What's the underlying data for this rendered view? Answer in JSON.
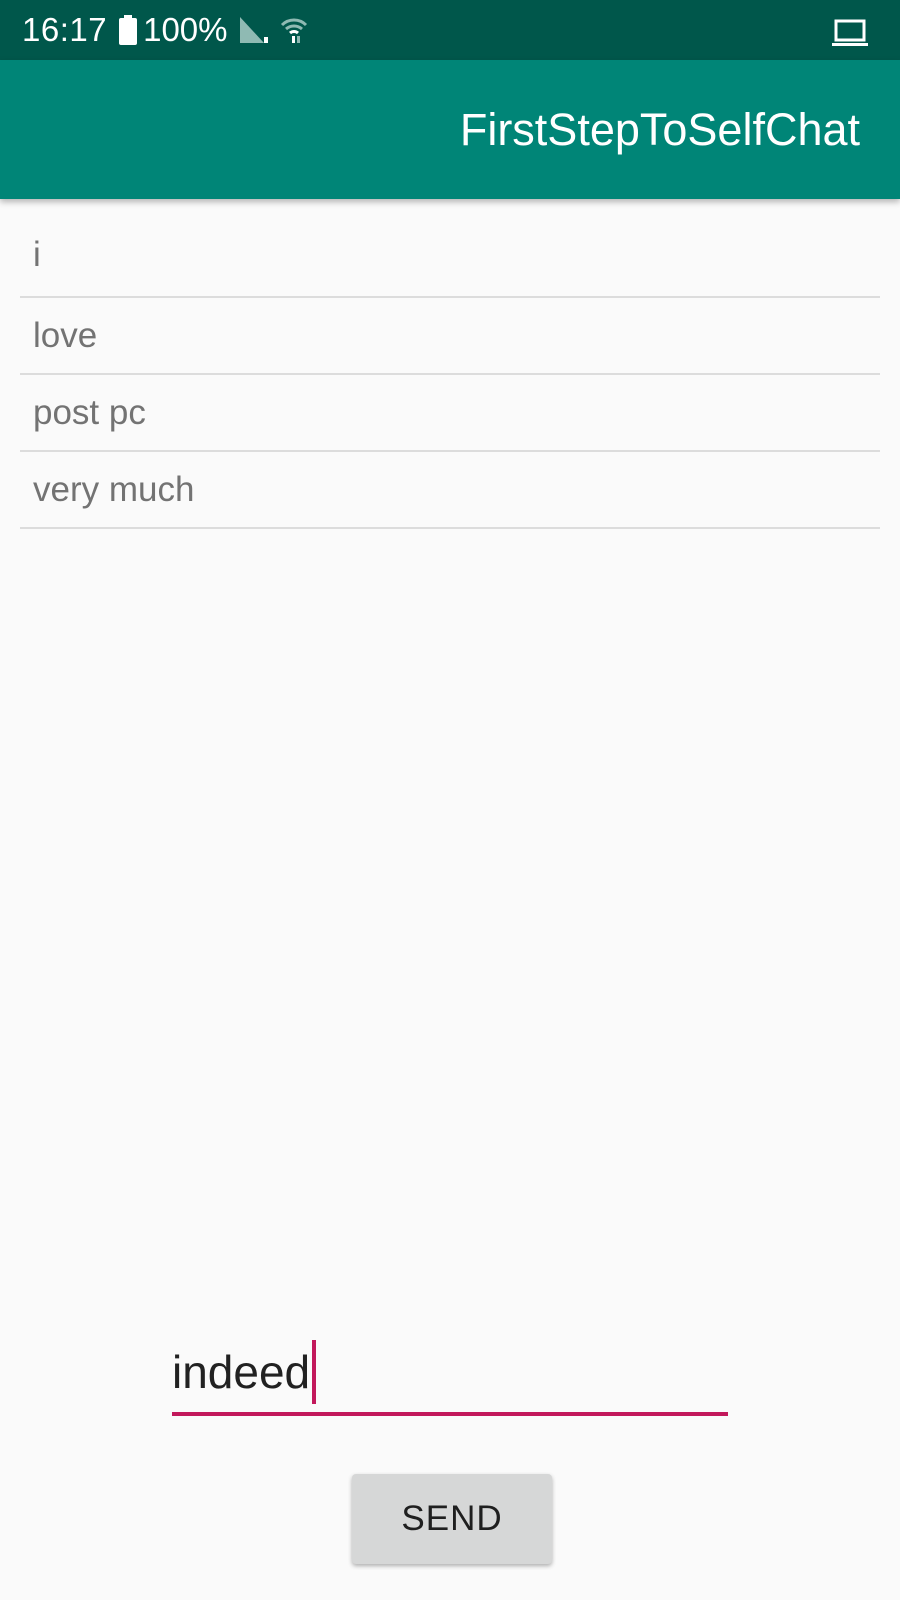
{
  "status_bar": {
    "time": "16:17",
    "battery_percent": "100%",
    "icons": [
      "battery-icon",
      "signal-icon",
      "wifi-icon",
      "laptop-icon"
    ]
  },
  "app_bar": {
    "title": "FirstStepToSelfChat",
    "color": "#008577"
  },
  "messages": [
    "i",
    "love",
    "post pc",
    "very much"
  ],
  "input": {
    "value": "indeed",
    "accent_color": "#c2185b"
  },
  "send_button": {
    "label": "SEND"
  },
  "colors": {
    "status_bar": "#00574b",
    "background": "#fafafa",
    "button": "#d6d7d7"
  }
}
